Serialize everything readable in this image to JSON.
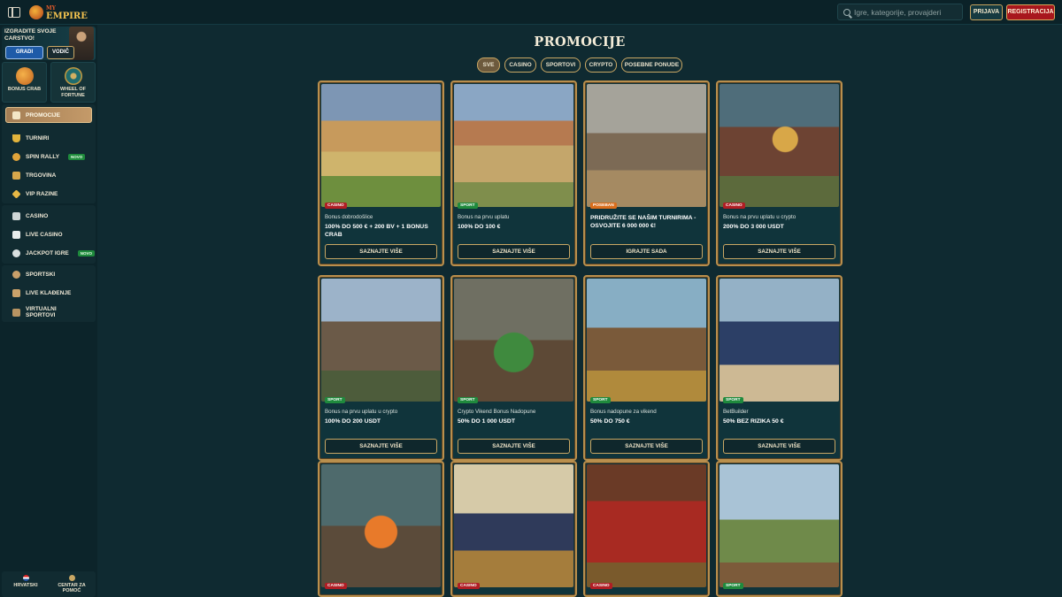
{
  "header": {
    "logo_top": "MY",
    "logo_main": "EMPIRE",
    "search_placeholder": "Igre, kategorije, provajderi",
    "login_label": "PRIJAVA",
    "register_label": "REGISTRACIJA"
  },
  "sidebar": {
    "promo_text": "IZGRADITE SVOJE CARSTVO!",
    "build_label": "GRADI",
    "guide_label": "VODIČ",
    "tiles": [
      {
        "label": "BONUS CRAB",
        "icon": "crab-icon"
      },
      {
        "label": "WHEEL OF FORTUNE",
        "icon": "wheel-icon"
      }
    ],
    "items": [
      {
        "label": "PROMOCIJE",
        "icon": "gift-icon"
      },
      {
        "label": "TURNIRI",
        "icon": "trophy-icon"
      },
      {
        "label": "SPIN RALLY",
        "icon": "rally-icon",
        "badge": "NOVO"
      },
      {
        "label": "TRGOVINA",
        "icon": "shop-icon"
      },
      {
        "label": "VIP RAZINE",
        "icon": "vip-icon"
      },
      {
        "label": "CASINO",
        "icon": "slot-icon"
      },
      {
        "label": "LIVE CASINO",
        "icon": "cards-icon"
      },
      {
        "label": "JACKPOT IGRE",
        "icon": "jackpot-icon",
        "badge": "NOVO"
      },
      {
        "label": "SPORTSKI",
        "icon": "ball-icon"
      },
      {
        "label": "LIVE KLAĐENJE",
        "icon": "live-icon"
      },
      {
        "label": "VIRTUALNI SPORTOVI",
        "icon": "virtual-icon"
      }
    ],
    "footer": {
      "language": "HRVATSKI",
      "help": "CENTAR ZA POMOĆ"
    }
  },
  "main": {
    "title": "PROMOCIJE",
    "filters": [
      "SVE",
      "CASINO",
      "SPORTOVI",
      "CRYPTO",
      "POSEBNE PONUDE"
    ],
    "active_filter": "SVE",
    "cards": [
      {
        "tag": "CASINO",
        "tag_type": "casino",
        "sub": "Bonus dobrodošlice",
        "title": "100% DO 500 € + 200 BV + 1 BONUS CRAB",
        "cta": "SAZNAJTE VIŠE"
      },
      {
        "tag": "SPORT",
        "tag_type": "sport",
        "sub": "Bonus na prvu uplatu",
        "title": "100% DO 100 €",
        "cta": "SAZNAJTE VIŠE"
      },
      {
        "tag": "POSEBAN",
        "tag_type": "special",
        "sub": "",
        "title": "PRIDRUŽITE SE NAŠIM TURNIRIMA - OSVOJITE 6 000 000 €!",
        "cta": "IGRAJTE SADA"
      },
      {
        "tag": "CASINO",
        "tag_type": "casino",
        "sub": "Bonus na prvu uplatu u crypto",
        "title": "200% DO 3 000 USDT",
        "cta": "SAZNAJTE VIŠE"
      },
      {
        "tag": "SPORT",
        "tag_type": "sport",
        "sub": "Bonus na prvu uplatu u crypto",
        "title": "100% DO 200 USDT",
        "cta": "SAZNAJTE VIŠE"
      },
      {
        "tag": "SPORT",
        "tag_type": "sport",
        "sub": "Crypto Vikend Bonus Nadopune",
        "title": "50% DO 1 000 USDT",
        "cta": "SAZNAJTE VIŠE"
      },
      {
        "tag": "SPORT",
        "tag_type": "sport",
        "sub": "Bonus nadopune za vikend",
        "title": "50% DO 750 €",
        "cta": "SAZNAJTE VIŠE"
      },
      {
        "tag": "SPORT",
        "tag_type": "sport",
        "sub": "BetBuilder",
        "title": "50% BEZ RIZIKA 50 €",
        "cta": "SAZNAJTE VIŠE"
      },
      {
        "tag": "CASINO",
        "tag_type": "casino",
        "sub": "",
        "title": "",
        "cta": ""
      },
      {
        "tag": "CASINO",
        "tag_type": "casino",
        "sub": "",
        "title": "",
        "cta": ""
      },
      {
        "tag": "CASINO",
        "tag_type": "casino",
        "sub": "",
        "title": "",
        "cta": ""
      },
      {
        "tag": "SPORT",
        "tag_type": "sport",
        "sub": "",
        "title": "",
        "cta": ""
      }
    ]
  }
}
